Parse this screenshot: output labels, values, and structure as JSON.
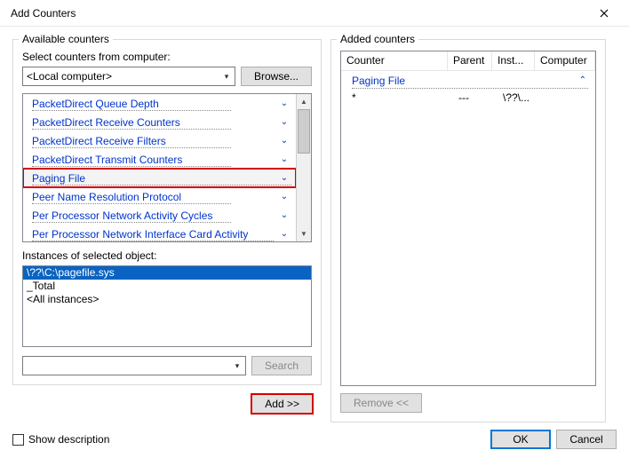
{
  "title": "Add Counters",
  "left": {
    "legend": "Available counters",
    "select_label": "Select counters from computer:",
    "computer_value": "<Local computer>",
    "browse_label": "Browse...",
    "counters": [
      "PacketDirect Queue Depth",
      "PacketDirect Receive Counters",
      "PacketDirect Receive Filters",
      "PacketDirect Transmit Counters",
      "Paging File",
      "Peer Name Resolution Protocol",
      "Per Processor Network Activity Cycles",
      "Per Processor Network Interface Card Activity"
    ],
    "dotted_widths": [
      224,
      224,
      224,
      224,
      292,
      224,
      224,
      272
    ],
    "selected_counter_index": 4,
    "instances_label": "Instances of selected object:",
    "instances": [
      "\\??\\C:\\pagefile.sys",
      "_Total",
      "<All instances>"
    ],
    "selected_instance_index": 0,
    "search_label": "Search",
    "add_label": "Add >>"
  },
  "right": {
    "legend": "Added counters",
    "columns": {
      "counter": "Counter",
      "parent": "Parent",
      "inst": "Inst...",
      "computer": "Computer"
    },
    "group_name": "Paging File",
    "rows": [
      {
        "counter": "*",
        "parent": "---",
        "inst": "\\??\\...",
        "computer": ""
      }
    ],
    "remove_label": "Remove <<"
  },
  "footer": {
    "show_desc": "Show description",
    "ok": "OK",
    "cancel": "Cancel"
  }
}
